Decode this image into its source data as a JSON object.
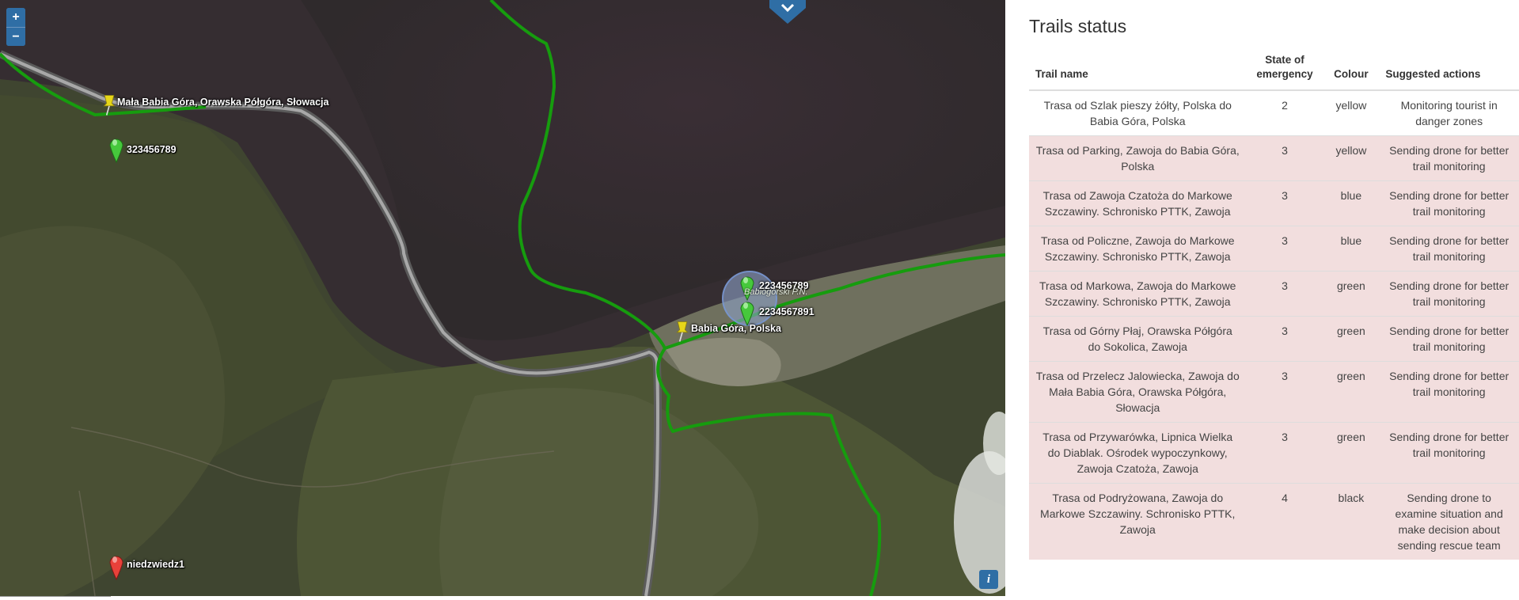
{
  "map": {
    "zoom_in": "+",
    "zoom_out": "−",
    "info": "i",
    "park_label": "Babiogórski P.N.",
    "colors": {
      "trail": "#169c0e",
      "road": "#a8a8a8",
      "marker_green": "#46c83c",
      "marker_yellow": "#e6d619",
      "marker_red": "#e8413a"
    },
    "markers": [
      {
        "label": "Mała Babia Góra, Orawska Półgóra, Słowacja",
        "type": "yellow-pushpin"
      },
      {
        "label": "323456789",
        "type": "green-pin"
      },
      {
        "label": "223456789",
        "type": "green-pin"
      },
      {
        "label": "2234567891",
        "type": "green-pin"
      },
      {
        "label": "Babia Góra, Polska",
        "type": "yellow-pushpin"
      },
      {
        "label": "niedzwiedz1",
        "type": "red-pin"
      }
    ]
  },
  "panel": {
    "title": "Trails status",
    "headers": [
      "Trail name",
      "State of emergency",
      "Colour",
      "Suggested actions"
    ],
    "rows": [
      {
        "name": "Trasa od Szlak pieszy żółty, Polska do Babia Góra, Polska",
        "state": "2",
        "colour": "yellow",
        "action": "Monitoring tourist in danger zones",
        "highlight": false
      },
      {
        "name": "Trasa od Parking, Zawoja do Babia Góra, Polska",
        "state": "3",
        "colour": "yellow",
        "action": "Sending drone for better trail monitoring",
        "highlight": true
      },
      {
        "name": "Trasa od Zawoja Czatoża do Markowe Szczawiny. Schronisko PTTK, Zawoja",
        "state": "3",
        "colour": "blue",
        "action": "Sending drone for better trail monitoring",
        "highlight": true
      },
      {
        "name": "Trasa od Policzne, Zawoja do Markowe Szczawiny. Schronisko PTTK, Zawoja",
        "state": "3",
        "colour": "blue",
        "action": "Sending drone for better trail monitoring",
        "highlight": true
      },
      {
        "name": "Trasa od Markowa, Zawoja do Markowe Szczawiny. Schronisko PTTK, Zawoja",
        "state": "3",
        "colour": "green",
        "action": "Sending drone for better trail monitoring",
        "highlight": true
      },
      {
        "name": "Trasa od Górny Płaj, Orawska Półgóra do Sokolica, Zawoja",
        "state": "3",
        "colour": "green",
        "action": "Sending drone for better trail monitoring",
        "highlight": true
      },
      {
        "name": "Trasa od Przelecz Jalowiecka, Zawoja do Mała Babia Góra, Orawska Półgóra, Słowacja",
        "state": "3",
        "colour": "green",
        "action": "Sending drone for better trail monitoring",
        "highlight": true
      },
      {
        "name": "Trasa od Przywarówka, Lipnica Wielka do Diablak. Ośrodek wypoczynkowy, Zawoja Czatoża, Zawoja",
        "state": "3",
        "colour": "green",
        "action": "Sending drone for better trail monitoring",
        "highlight": true
      },
      {
        "name": "Trasa od Podryżowana, Zawoja do Markowe Szczawiny. Schronisko PTTK, Zawoja",
        "state": "4",
        "colour": "black",
        "action": "Sending drone to examine situation and make decision about sending rescue team",
        "highlight": true
      }
    ]
  }
}
